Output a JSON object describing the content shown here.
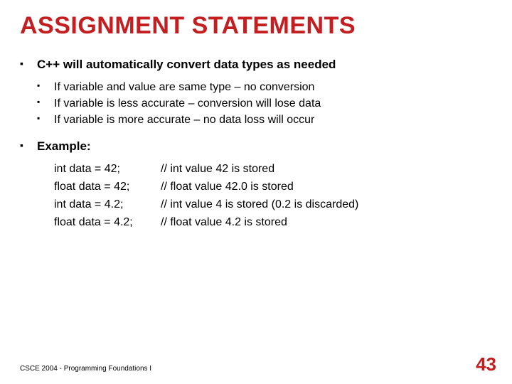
{
  "title": "ASSIGNMENT STATEMENTS",
  "bullet1": "C++ will automatically convert data types as needed",
  "sub1": "If variable and value are same type – no conversion",
  "sub2": "If variable is less accurate – conversion will lose data",
  "sub3": "If variable is more accurate – no data loss will occur",
  "bullet2": "Example:",
  "examples": {
    "r1c": "int data = 42;",
    "r1m": "// int value 42 is stored",
    "r2c": "float data = 42;",
    "r2m": "// float value 42.0 is stored",
    "r3c": "int data = 4.2;",
    "r3m": "// int value 4 is stored (0.2 is discarded)",
    "r4c": "float data = 4.2;",
    "r4m": "// float value 4.2 is stored"
  },
  "footer": "CSCE 2004 - Programming Foundations I",
  "page": "43"
}
